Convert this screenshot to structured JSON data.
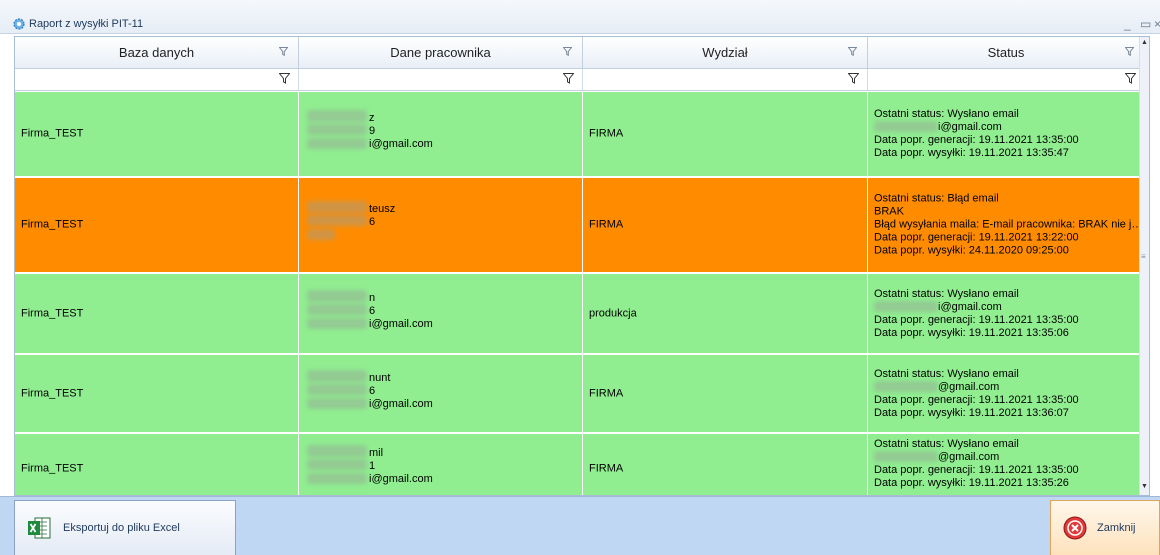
{
  "window": {
    "title": "Raport z wysyłki PIT-11",
    "minimize_glyph": "_",
    "maximize_glyph": "▭",
    "close_glyph": "×"
  },
  "columns": [
    {
      "label": "Baza danych"
    },
    {
      "label": "Dane pracownika"
    },
    {
      "label": "Wydział"
    },
    {
      "label": "Status"
    }
  ],
  "rows": [
    {
      "state": "ok",
      "database": "Firma_TEST",
      "employee": [
        "z",
        "9",
        "i@gmail.com"
      ],
      "department": "FIRMA",
      "status": [
        "Ostatni status: Wysłano email",
        "i@gmail.com",
        "Data popr. generacji: 19.11.2021 13:35:00",
        "Data popr. wysyłki: 19.11.2021 13:35:47"
      ]
    },
    {
      "state": "err",
      "database": "Firma_TEST",
      "employee": [
        "teusz",
        "6",
        ""
      ],
      "department": "FIRMA",
      "status": [
        "Ostatni status: Błąd email",
        "BRAK",
        "Błąd wysyłania maila: E-mail pracownika: BRAK nie jest prawidłowym adresem e-mail.",
        "Data popr. generacji: 19.11.2021 13:22:00",
        "Data popr. wysyłki: 24.11.2020 09:25:00"
      ]
    },
    {
      "state": "ok",
      "database": "Firma_TEST",
      "employee": [
        "n",
        "6",
        "i@gmail.com"
      ],
      "department": "produkcja",
      "status": [
        "Ostatni status: Wysłano email",
        "i@gmail.com",
        "Data popr. generacji: 19.11.2021 13:35:00",
        "Data popr. wysyłki: 19.11.2021 13:35:06"
      ]
    },
    {
      "state": "ok",
      "database": "Firma_TEST",
      "employee": [
        "nunt",
        "6",
        "i@gmail.com"
      ],
      "department": "FIRMA",
      "status": [
        "Ostatni status: Wysłano email",
        "@gmail.com",
        "Data popr. generacji: 19.11.2021 13:35:00",
        "Data popr. wysyłki: 19.11.2021 13:36:07"
      ]
    },
    {
      "state": "ok",
      "database": "Firma_TEST",
      "employee": [
        "mil",
        "1",
        "i@gmail.com"
      ],
      "department": "FIRMA",
      "status": [
        "Ostatni status: Wysłano email",
        "@gmail.com",
        "Data popr. generacji: 19.11.2021 13:35:00",
        "Data popr. wysyłki: 19.11.2021 13:35:26"
      ]
    }
  ],
  "footer": {
    "export_label": "Eksportuj do pliku Excel",
    "close_label": "Zamknij"
  },
  "colors": {
    "ok_row": "#90ee90",
    "error_row": "#ff8c00",
    "footer": "#bfd7f3"
  },
  "icons": {
    "app": "gear-icon",
    "filter": "filter-icon",
    "excel": "excel-icon",
    "close": "close-circle-icon"
  }
}
